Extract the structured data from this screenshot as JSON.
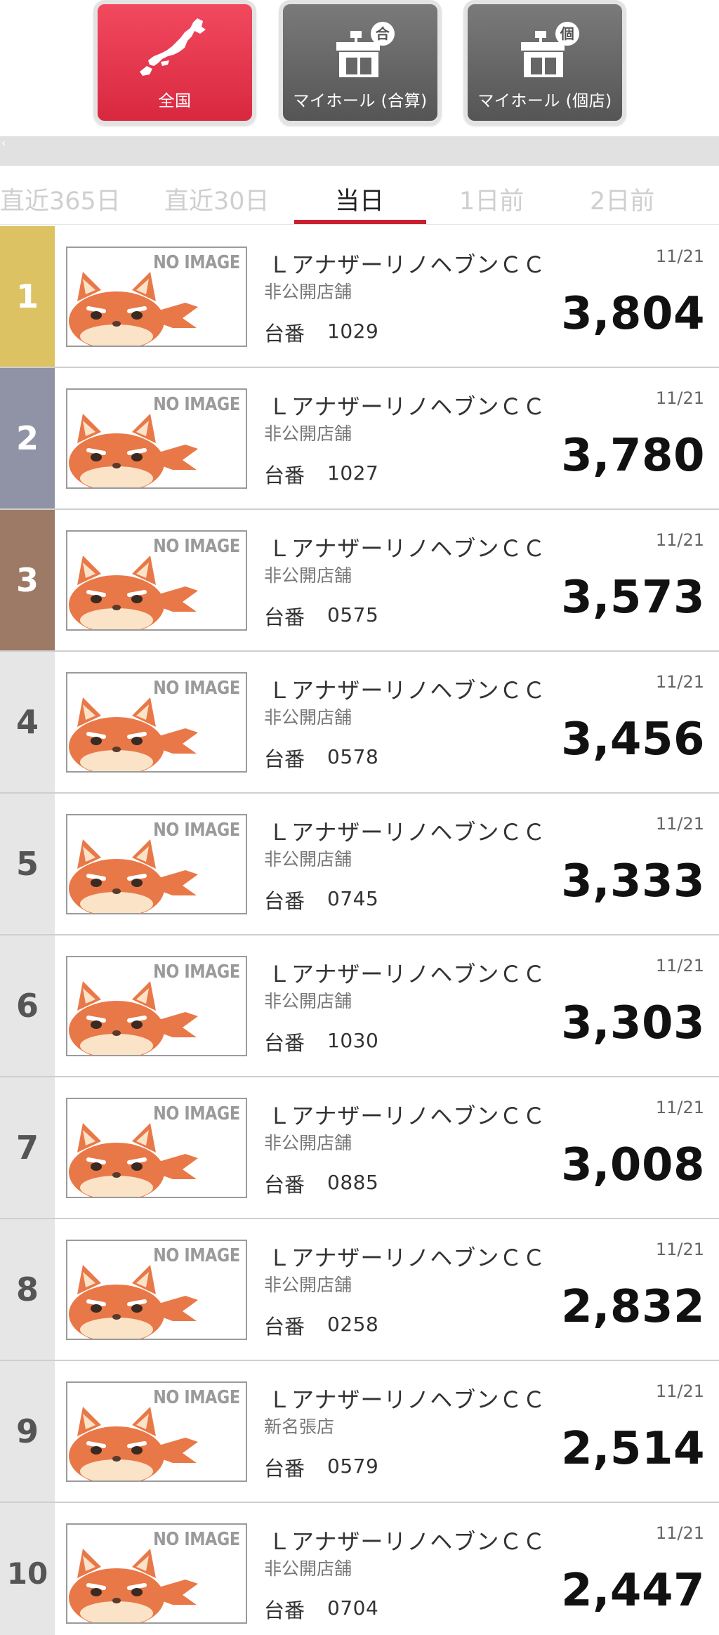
{
  "modes": [
    {
      "label": "全国",
      "icon": "japan-map-icon"
    },
    {
      "label": "マイホール (合算)",
      "icon": "store-combined-icon",
      "badge": "合"
    },
    {
      "label": "マイホール (個店)",
      "icon": "store-single-icon",
      "badge": "個"
    }
  ],
  "tabs": [
    "直近365日",
    "直近30日",
    "当日",
    "1日前",
    "2日前"
  ],
  "active_tab": "当日",
  "thumbnail_text": "NO IMAGE",
  "stand_label": "台番",
  "colors": {
    "accent": "#c8202e",
    "gold": "#dcc262",
    "silver": "#8f93a5",
    "bronze": "#9c7a66"
  },
  "ranking": [
    {
      "rank": "1",
      "name": "ＬアナザーリノヘブンＣＣ",
      "store": "非公開店舗",
      "stand": "1029",
      "date": "11/21",
      "value": "3,804"
    },
    {
      "rank": "2",
      "name": "ＬアナザーリノヘブンＣＣ",
      "store": "非公開店舗",
      "stand": "1027",
      "date": "11/21",
      "value": "3,780"
    },
    {
      "rank": "3",
      "name": "ＬアナザーリノヘブンＣＣ",
      "store": "非公開店舗",
      "stand": "0575",
      "date": "11/21",
      "value": "3,573"
    },
    {
      "rank": "4",
      "name": "ＬアナザーリノヘブンＣＣ",
      "store": "非公開店舗",
      "stand": "0578",
      "date": "11/21",
      "value": "3,456"
    },
    {
      "rank": "5",
      "name": "ＬアナザーリノヘブンＣＣ",
      "store": "非公開店舗",
      "stand": "0745",
      "date": "11/21",
      "value": "3,333"
    },
    {
      "rank": "6",
      "name": "ＬアナザーリノヘブンＣＣ",
      "store": "非公開店舗",
      "stand": "1030",
      "date": "11/21",
      "value": "3,303"
    },
    {
      "rank": "7",
      "name": "ＬアナザーリノヘブンＣＣ",
      "store": "非公開店舗",
      "stand": "0885",
      "date": "11/21",
      "value": "3,008"
    },
    {
      "rank": "8",
      "name": "ＬアナザーリノヘブンＣＣ",
      "store": "非公開店舗",
      "stand": "0258",
      "date": "11/21",
      "value": "2,832"
    },
    {
      "rank": "9",
      "name": "ＬアナザーリノヘブンＣＣ",
      "store": "新名張店",
      "stand": "0579",
      "date": "11/21",
      "value": "2,514"
    },
    {
      "rank": "10",
      "name": "ＬアナザーリノヘブンＣＣ",
      "store": "非公開店舗",
      "stand": "0704",
      "date": "11/21",
      "value": "2,447"
    }
  ]
}
